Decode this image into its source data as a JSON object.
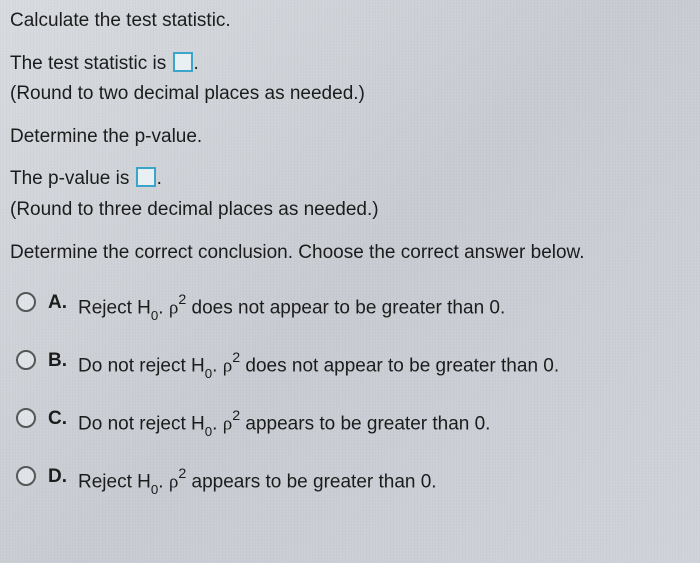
{
  "prompt1": "Calculate the test statistic.",
  "stat_line_prefix": "The test statistic is ",
  "stat_line_suffix": ".",
  "round2": "(Round to two decimal places as needed.)",
  "prompt2": "Determine the p-value.",
  "pval_line_prefix": "The p-value is ",
  "pval_line_suffix": ".",
  "round3": "(Round to three decimal places as needed.)",
  "prompt3": "Determine the correct conclusion. Choose the correct answer below.",
  "options": {
    "a": {
      "letter": "A.",
      "prefix": "Reject H",
      "sub": "0",
      "mid": ". ",
      "rho": "ρ",
      "sup": "2",
      "suffix": " does not appear to be greater than 0."
    },
    "b": {
      "letter": "B.",
      "prefix": "Do not reject H",
      "sub": "0",
      "mid": ". ",
      "rho": "ρ",
      "sup": "2",
      "suffix": " does not appear to be greater than 0."
    },
    "c": {
      "letter": "C.",
      "prefix": "Do not reject H",
      "sub": "0",
      "mid": ". ",
      "rho": "ρ",
      "sup": "2",
      "suffix": " appears to be greater than 0."
    },
    "d": {
      "letter": "D.",
      "prefix": "Reject H",
      "sub": "0",
      "mid": ". ",
      "rho": "ρ",
      "sup": "2",
      "suffix": " appears to be greater than 0."
    }
  }
}
